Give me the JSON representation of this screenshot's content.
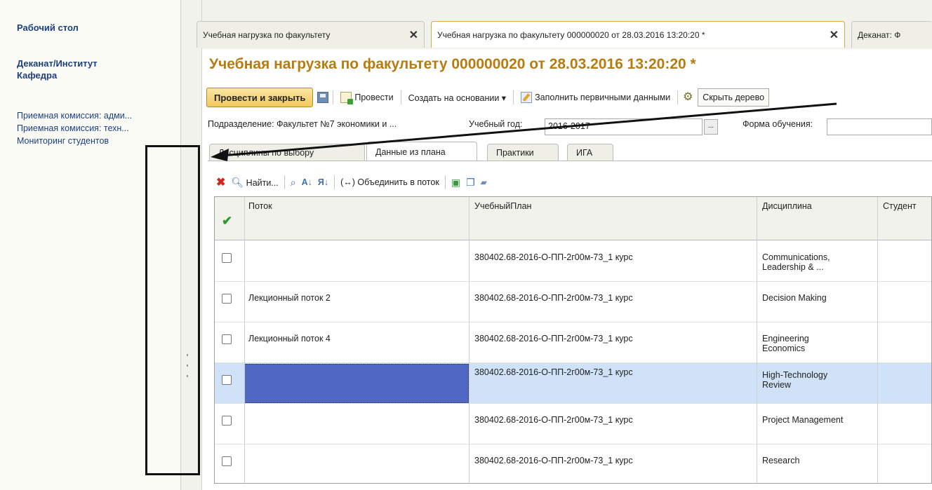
{
  "sidebar": {
    "desktop": "Рабочий стол",
    "section": "Деканат/Институт\nКафедра",
    "section_line1": "Деканат/Институт",
    "section_line2": "Кафедра",
    "links": [
      "Приемная комиссия: адми...",
      "Приемная комиссия: техн...",
      "Мониторинг студентов"
    ]
  },
  "tabs": [
    {
      "label": "Учебная нагрузка по факультету",
      "close": "✕"
    },
    {
      "label": "Учебная нагрузка по факультету 000000020 от 28.03.2016 13:20:20 *",
      "close": "✕"
    },
    {
      "label": "Деканат: Ф"
    }
  ],
  "document": {
    "title": "Учебная нагрузка по факультету 000000020 от 28.03.2016 13:20:20 *"
  },
  "toolbar": {
    "post_close": "Провести и закрыть",
    "post": "Провести",
    "create_based": "Создать на основании ▾",
    "fill_primary": "Заполнить первичными данными",
    "hide_tree": "Скрыть дерево"
  },
  "filters": {
    "division_label": "Подразделение:",
    "division_value": "Факультет №7 экономики и ...",
    "year_label": "Учебный год:",
    "year_value": "2016-2017",
    "form_label": "Форма обучения:",
    "dots": "..."
  },
  "subtabs": [
    "Дисциплины по выбору",
    "Данные из плана",
    "Практики",
    "ИГА"
  ],
  "grid_toolbar": {
    "find": "Найти...",
    "merge": "(↔) Объединить в поток"
  },
  "table": {
    "columns": [
      "Поток",
      "УчебныйПлан",
      "Дисциплина",
      "Студент"
    ],
    "rows": [
      {
        "stream": "",
        "plan": "380402.68-2016-О-ПП-2г00м-73_1 курс",
        "discipline_1": "Communications,",
        "discipline_2": "Leadership & ..."
      },
      {
        "stream": "Лекционный поток 2",
        "plan": "380402.68-2016-О-ПП-2г00м-73_1 курс",
        "discipline_1": "Decision Making",
        "discipline_2": ""
      },
      {
        "stream": "Лекционный поток 4",
        "plan": "380402.68-2016-О-ПП-2г00м-73_1 курс",
        "discipline_1": "Engineering",
        "discipline_2": "Economics"
      },
      {
        "stream": "",
        "plan": "380402.68-2016-О-ПП-2г00м-73_1 курс",
        "discipline_1": "High-Technology",
        "discipline_2": "Review"
      },
      {
        "stream": "",
        "plan": "380402.68-2016-О-ПП-2г00м-73_1 курс",
        "discipline_1": "Project Management",
        "discipline_2": ""
      },
      {
        "stream": "",
        "plan": "380402.68-2016-О-ПП-2г00м-73_1 курс",
        "discipline_1": "Research",
        "discipline_2": ""
      }
    ]
  },
  "colors": {
    "title": "#b77c10",
    "link": "#1c3f82",
    "selected_row": "#cfe2f7",
    "selected_cell": "#5068c4"
  }
}
